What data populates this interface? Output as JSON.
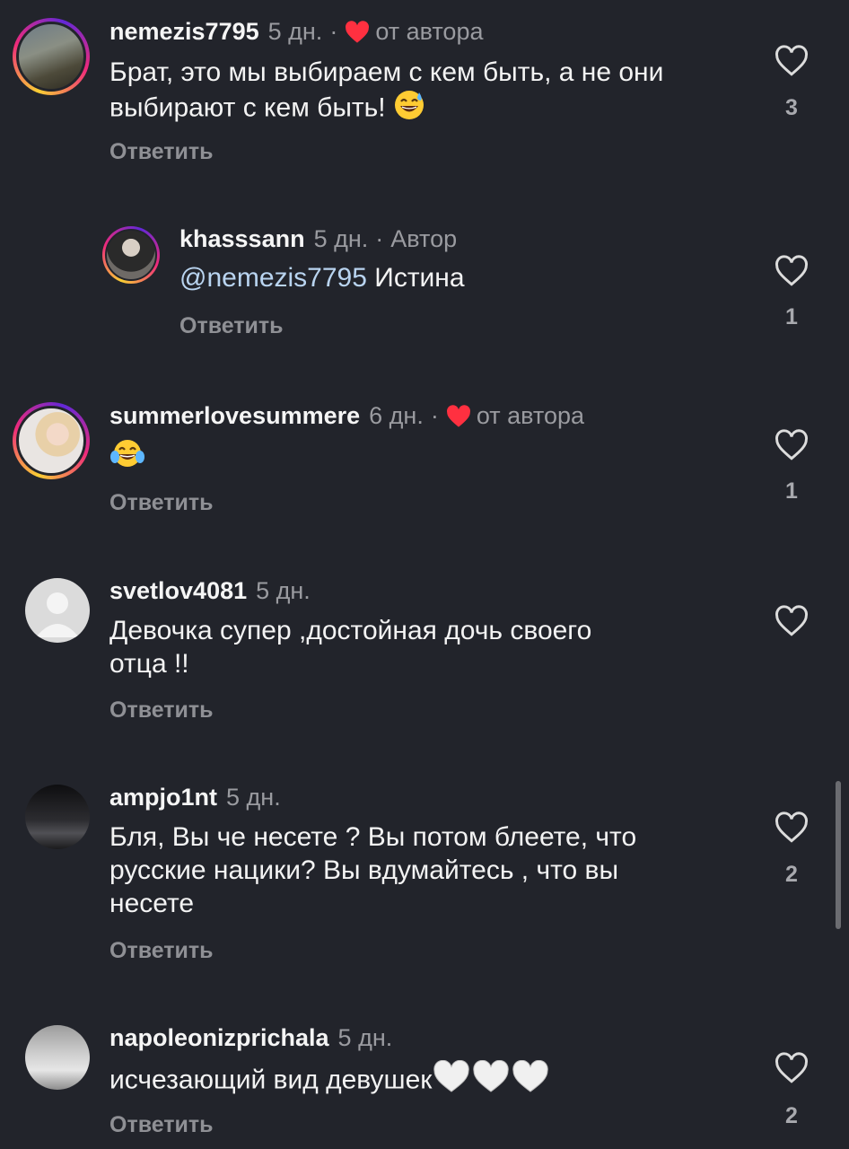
{
  "comments": [
    {
      "username": "nemezis7795",
      "time": "5 дн.",
      "separator": "·",
      "badge": "от автора",
      "text": "Брат, это мы выбираем с кем быть, а не они выбирают с кем быть!",
      "reply_label": "Ответить",
      "likes": "3"
    },
    {
      "username": "khasssann",
      "time": "5 дн.",
      "separator": "·",
      "badge": "Автор",
      "mention": "@nemezis7795",
      "text": "Истина",
      "reply_label": "Ответить",
      "likes": "1"
    },
    {
      "username": "summerlovesummere",
      "time": "6 дн.",
      "separator": "·",
      "badge": "от автора",
      "text": "",
      "reply_label": "Ответить",
      "likes": "1"
    },
    {
      "username": "svetlov4081",
      "time": "5 дн.",
      "text_line1": "Девочка супер ,достойная дочь своего",
      "text_line2": "отца !!",
      "reply_label": "Ответить",
      "likes": ""
    },
    {
      "username": "ampjo1nt",
      "time": "5 дн.",
      "text_line1": "Бля, Вы че несете ? Вы потом блеете, что",
      "text_line2": "русские нацики? Вы вдумайтесь , что вы",
      "text_line3": "несете",
      "reply_label": "Ответить",
      "likes": "2"
    },
    {
      "username": "napoleonizprichala",
      "time": "5 дн.",
      "text": "исчезающий вид девушек",
      "reply_label": "Ответить",
      "likes": "2"
    }
  ],
  "colors": {
    "background": "#22242b",
    "heart_red": "#ff3040",
    "muted": "#9a9ba0",
    "mention": "#b9d4f0"
  },
  "icons": {
    "like": "heart-outline-icon",
    "author_like": "heart-filled-icon",
    "emoji_sweat_smile": "grinning-sweat-emoji",
    "emoji_tears_joy": "tears-of-joy-emoji",
    "emoji_white_heart": "white-heart-emoji"
  }
}
